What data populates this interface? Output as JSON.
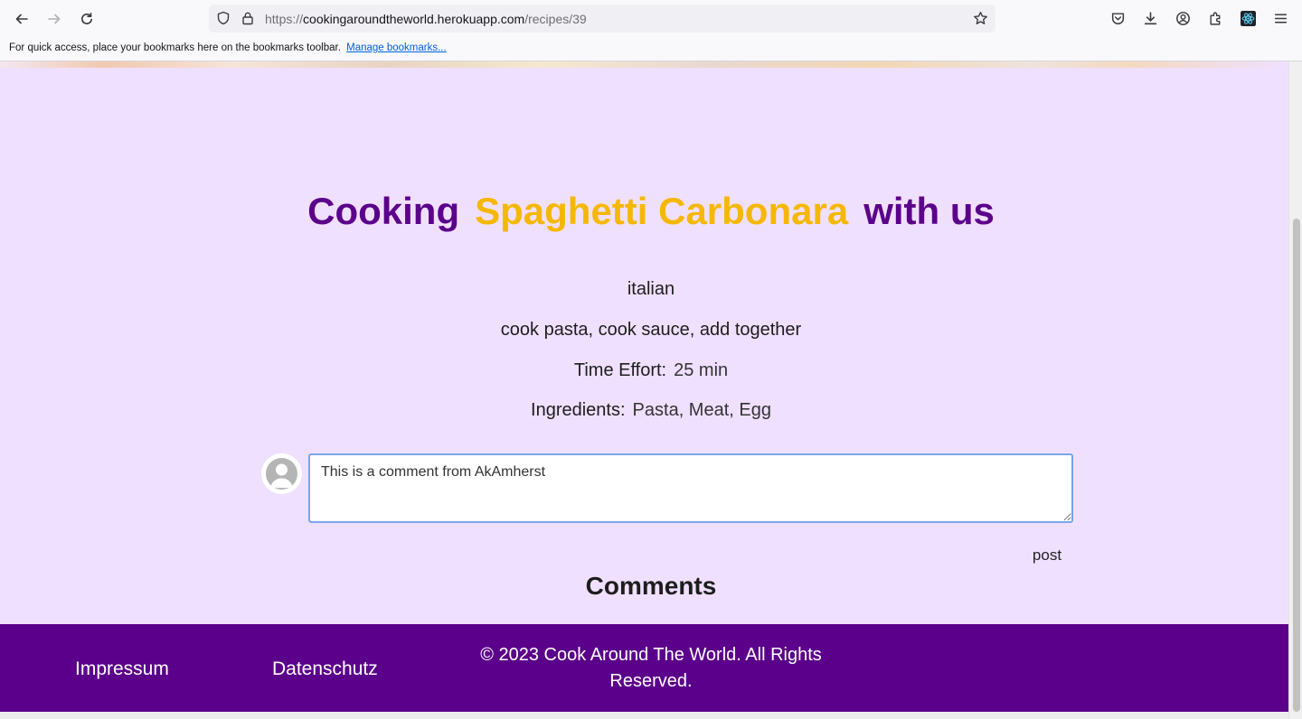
{
  "browser": {
    "url_prefix": "https://",
    "url_domain": "cookingaroundtheworld.herokuapp.com",
    "url_path": "/recipes/39",
    "bookmarks_message": "For quick access, place your bookmarks here on the bookmarks toolbar.",
    "manage_bookmarks": "Manage bookmarks..."
  },
  "recipe": {
    "title_prefix": "Cooking",
    "title_name": "Spaghetti Carbonara",
    "title_suffix": "with us",
    "cuisine": "italian",
    "instructions": "cook pasta, cook sauce, add together",
    "time_label": "Time Effort:",
    "time_value": "25 min",
    "ingredients_label": "Ingredients:",
    "ingredients_value": "Pasta, Meat, Egg"
  },
  "comment_form": {
    "value": "This is a comment from AkAmherst",
    "post_label": "post"
  },
  "comments": {
    "heading": "Comments"
  },
  "footer": {
    "impressum": "Impressum",
    "datenschutz": "Datenschutz",
    "copyright": "© 2023 Cook Around The World. All Rights Reserved."
  },
  "colors": {
    "accent_purple": "#5b008a",
    "accent_gold": "#f5b800",
    "page_background": "#f0e0ff"
  }
}
